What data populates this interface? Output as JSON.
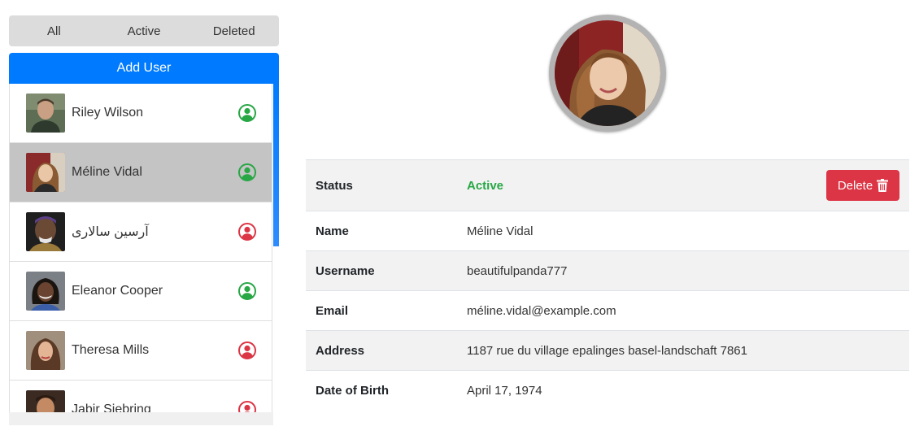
{
  "filters": {
    "all": "All",
    "active": "Active",
    "deleted": "Deleted"
  },
  "add_user_label": "Add User",
  "users": [
    {
      "name": "Riley Wilson",
      "status": "active",
      "selected": false
    },
    {
      "name": "Méline Vidal",
      "status": "active",
      "selected": true
    },
    {
      "name": "آرسین سالاری",
      "status": "deleted",
      "selected": false
    },
    {
      "name": "Eleanor Cooper",
      "status": "active",
      "selected": false
    },
    {
      "name": "Theresa Mills",
      "status": "deleted",
      "selected": false
    },
    {
      "name": "Jabir Siebring",
      "status": "deleted",
      "selected": false
    }
  ],
  "colors": {
    "active": "#28a745",
    "deleted": "#dc3545",
    "primary": "#007bff",
    "selected_row": "#c4c4c4"
  },
  "icons": {
    "status": "user-circle-icon",
    "delete": "trash-icon"
  },
  "detail": {
    "status_label": "Status",
    "status_value": "Active",
    "delete_label": "Delete",
    "name_label": "Name",
    "name_value": "Méline Vidal",
    "username_label": "Username",
    "username_value": "beautifulpanda777",
    "email_label": "Email",
    "email_value": "méline.vidal@example.com",
    "address_label": "Address",
    "address_value": "1187 rue du village epalinges basel-landschaft 7861",
    "dob_label": "Date of Birth",
    "dob_value": "April 17, 1974"
  }
}
